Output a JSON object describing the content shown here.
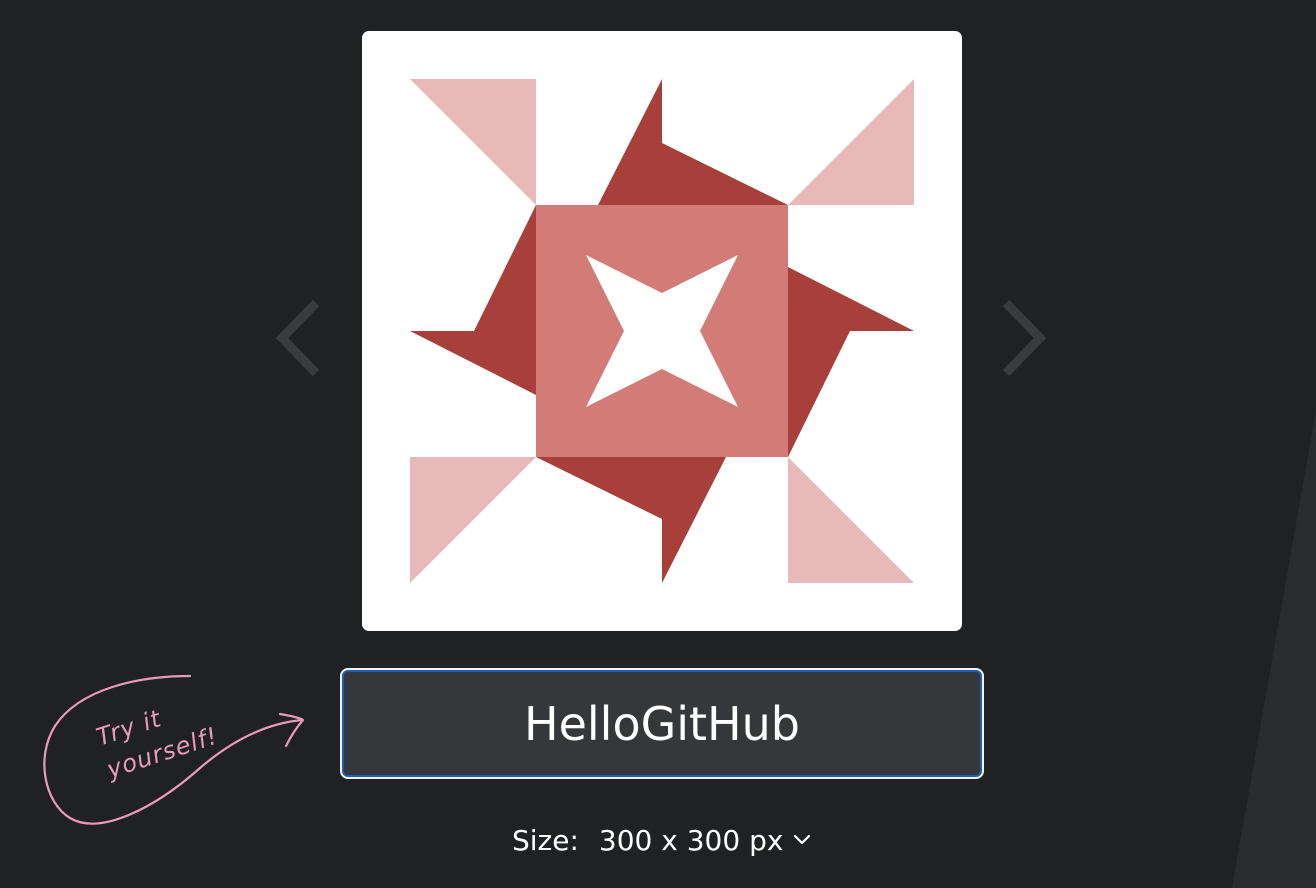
{
  "avatar": {
    "colors": {
      "background": "#ffffff",
      "light_pink": "#e8b9b9",
      "dark_red": "#a7403b",
      "medium_red": "#d27b77"
    }
  },
  "navigation": {
    "prev_icon": "chevron-left-icon",
    "next_icon": "chevron-right-icon",
    "arrow_color": "#3a3b3e"
  },
  "name_input": {
    "value": "HelloGitHub",
    "border_color": "#1c5fb8"
  },
  "size": {
    "label": "Size:",
    "value": "300 x 300 px",
    "icon": "chevron-down-icon"
  },
  "annotation": {
    "line1": "Try it",
    "line2": "yourself!",
    "color": "#e89cb6"
  },
  "theme": {
    "page_background": "#202123"
  }
}
